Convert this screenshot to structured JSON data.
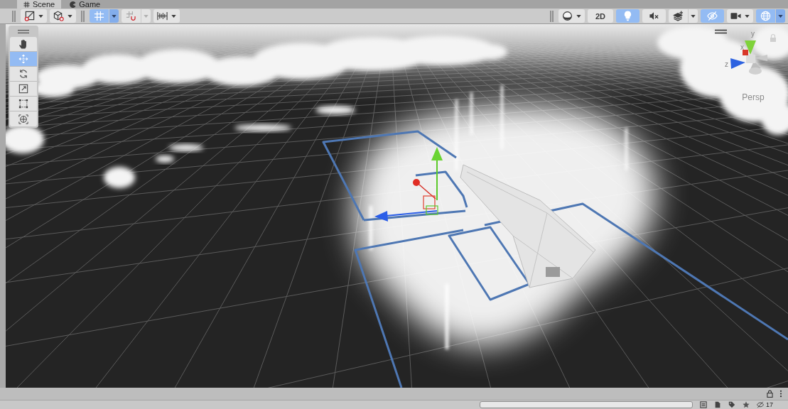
{
  "tabs": [
    {
      "label": "Scene",
      "selected": true
    },
    {
      "label": "Game",
      "selected": false
    }
  ],
  "toolbar": {
    "left": [
      {
        "kind": "dropdown",
        "on": false,
        "disabled": false
      },
      {
        "kind": "dropdown",
        "on": false,
        "disabled": false
      },
      {
        "kind": "split",
        "on": true,
        "disabled": false
      },
      {
        "kind": "split",
        "on": false,
        "disabled": true
      },
      {
        "kind": "dropdown",
        "on": false,
        "disabled": false
      }
    ],
    "right": [
      {
        "kind": "dropdown",
        "on": false,
        "disabled": false
      },
      {
        "kind": "text",
        "label": "2D",
        "on": false,
        "disabled": false
      },
      {
        "kind": "toggle",
        "on": true,
        "disabled": false
      },
      {
        "kind": "toggle",
        "on": false,
        "disabled": false
      },
      {
        "kind": "split",
        "on": false,
        "disabled": false
      },
      {
        "kind": "toggle",
        "on": true,
        "disabled": false
      },
      {
        "kind": "dropdown",
        "on": false,
        "disabled": false
      },
      {
        "kind": "split",
        "on": true,
        "disabled": false
      }
    ]
  },
  "tools": [
    {
      "selected": false
    },
    {
      "selected": true
    },
    {
      "selected": false
    },
    {
      "selected": false
    },
    {
      "selected": false
    },
    {
      "selected": false
    }
  ],
  "scene": {
    "axis_labels": [
      "y",
      "x",
      "z"
    ],
    "view_mode": "Persp"
  },
  "project_toolbar": {
    "hidden_count": "17"
  }
}
